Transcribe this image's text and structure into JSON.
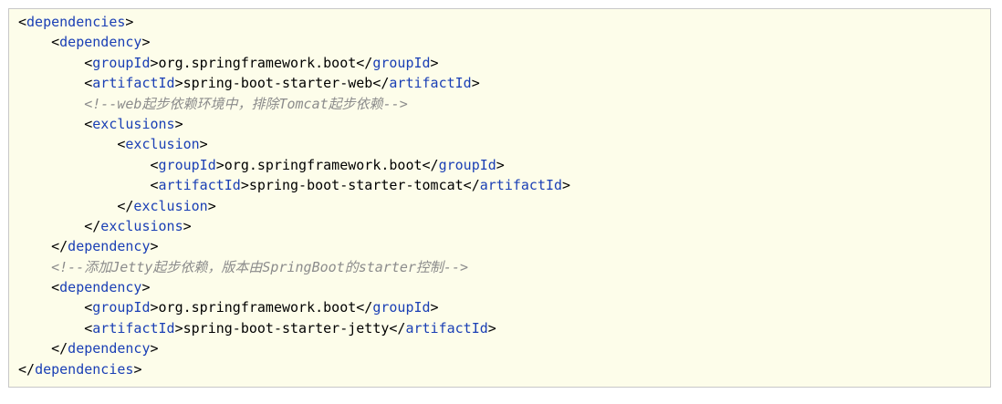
{
  "code": {
    "lines": [
      {
        "indent": 0,
        "tokens": [
          {
            "k": "p",
            "v": "<"
          },
          {
            "k": "t",
            "v": "dependencies"
          },
          {
            "k": "p",
            "v": ">"
          }
        ]
      },
      {
        "indent": 1,
        "tokens": [
          {
            "k": "p",
            "v": "<"
          },
          {
            "k": "t",
            "v": "dependency"
          },
          {
            "k": "p",
            "v": ">"
          }
        ]
      },
      {
        "indent": 2,
        "tokens": [
          {
            "k": "p",
            "v": "<"
          },
          {
            "k": "t",
            "v": "groupId"
          },
          {
            "k": "p",
            "v": ">"
          },
          {
            "k": "x",
            "v": "org.springframework.boot"
          },
          {
            "k": "p",
            "v": "</"
          },
          {
            "k": "t",
            "v": "groupId"
          },
          {
            "k": "p",
            "v": ">"
          }
        ]
      },
      {
        "indent": 2,
        "tokens": [
          {
            "k": "p",
            "v": "<"
          },
          {
            "k": "t",
            "v": "artifactId"
          },
          {
            "k": "p",
            "v": ">"
          },
          {
            "k": "x",
            "v": "spring-boot-starter-web"
          },
          {
            "k": "p",
            "v": "</"
          },
          {
            "k": "t",
            "v": "artifactId"
          },
          {
            "k": "p",
            "v": ">"
          }
        ]
      },
      {
        "indent": 2,
        "tokens": [
          {
            "k": "c",
            "v": "<!--web起步依赖环境中，排除Tomcat起步依赖-->"
          }
        ]
      },
      {
        "indent": 2,
        "tokens": [
          {
            "k": "p",
            "v": "<"
          },
          {
            "k": "t",
            "v": "exclusions"
          },
          {
            "k": "p",
            "v": ">"
          }
        ]
      },
      {
        "indent": 3,
        "tokens": [
          {
            "k": "p",
            "v": "<"
          },
          {
            "k": "t",
            "v": "exclusion"
          },
          {
            "k": "p",
            "v": ">"
          }
        ]
      },
      {
        "indent": 4,
        "tokens": [
          {
            "k": "p",
            "v": "<"
          },
          {
            "k": "t",
            "v": "groupId"
          },
          {
            "k": "p",
            "v": ">"
          },
          {
            "k": "x",
            "v": "org.springframework.boot"
          },
          {
            "k": "p",
            "v": "</"
          },
          {
            "k": "t",
            "v": "groupId"
          },
          {
            "k": "p",
            "v": ">"
          }
        ]
      },
      {
        "indent": 4,
        "tokens": [
          {
            "k": "p",
            "v": "<"
          },
          {
            "k": "t",
            "v": "artifactId"
          },
          {
            "k": "p",
            "v": ">"
          },
          {
            "k": "x",
            "v": "spring-boot-starter-tomcat"
          },
          {
            "k": "p",
            "v": "</"
          },
          {
            "k": "t",
            "v": "artifactId"
          },
          {
            "k": "p",
            "v": ">"
          }
        ]
      },
      {
        "indent": 3,
        "tokens": [
          {
            "k": "p",
            "v": "</"
          },
          {
            "k": "t",
            "v": "exclusion"
          },
          {
            "k": "p",
            "v": ">"
          }
        ]
      },
      {
        "indent": 2,
        "tokens": [
          {
            "k": "p",
            "v": "</"
          },
          {
            "k": "t",
            "v": "exclusions"
          },
          {
            "k": "p",
            "v": ">"
          }
        ]
      },
      {
        "indent": 1,
        "tokens": [
          {
            "k": "p",
            "v": "</"
          },
          {
            "k": "t",
            "v": "dependency"
          },
          {
            "k": "p",
            "v": ">"
          }
        ]
      },
      {
        "indent": 1,
        "tokens": [
          {
            "k": "c",
            "v": "<!--添加Jetty起步依赖，版本由SpringBoot的starter控制-->"
          }
        ]
      },
      {
        "indent": 1,
        "tokens": [
          {
            "k": "p",
            "v": "<"
          },
          {
            "k": "t",
            "v": "dependency"
          },
          {
            "k": "p",
            "v": ">"
          }
        ]
      },
      {
        "indent": 2,
        "tokens": [
          {
            "k": "p",
            "v": "<"
          },
          {
            "k": "t",
            "v": "groupId"
          },
          {
            "k": "p",
            "v": ">"
          },
          {
            "k": "x",
            "v": "org.springframework.boot"
          },
          {
            "k": "p",
            "v": "</"
          },
          {
            "k": "t",
            "v": "groupId"
          },
          {
            "k": "p",
            "v": ">"
          }
        ]
      },
      {
        "indent": 2,
        "tokens": [
          {
            "k": "p",
            "v": "<"
          },
          {
            "k": "t",
            "v": "artifactId"
          },
          {
            "k": "p",
            "v": ">"
          },
          {
            "k": "x",
            "v": "spring-boot-starter-jetty"
          },
          {
            "k": "p",
            "v": "</"
          },
          {
            "k": "t",
            "v": "artifactId"
          },
          {
            "k": "p",
            "v": ">"
          }
        ]
      },
      {
        "indent": 1,
        "tokens": [
          {
            "k": "p",
            "v": "</"
          },
          {
            "k": "t",
            "v": "dependency"
          },
          {
            "k": "p",
            "v": ">"
          }
        ]
      },
      {
        "indent": 0,
        "tokens": [
          {
            "k": "p",
            "v": "</"
          },
          {
            "k": "t",
            "v": "dependencies"
          },
          {
            "k": "p",
            "v": ">"
          }
        ]
      }
    ]
  }
}
